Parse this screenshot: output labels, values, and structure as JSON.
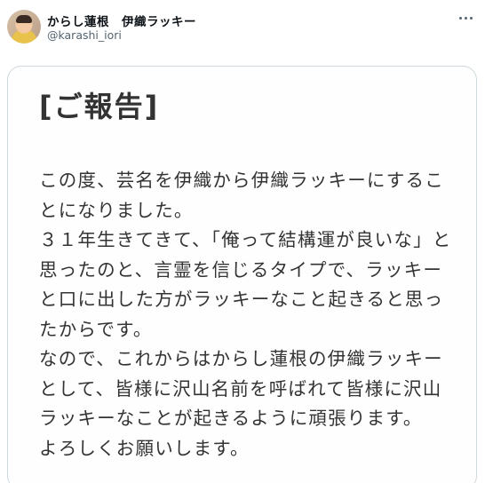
{
  "user": {
    "display_name": "からし蓮根　伊織ラッキー",
    "handle": "@karashi_iori"
  },
  "menu": {
    "icon": "more-horizontal-icon"
  },
  "image": {
    "title": "[ご報告]",
    "lines": [
      "この度、芸名を伊織から伊織ラッキーにするこ",
      "とになりました。",
      "３１年生きてきて、「俺って結構運が良いな」と",
      "思ったのと、言霊を信じるタイプで、ラッキー",
      "と口に出した方がラッキーなこと起きると思っ",
      "たからです。",
      "なので、これからはからし蓮根の伊織ラッキー",
      "として、皆様に沢山名前を呼ばれて皆様に沢山",
      "ラッキーなことが起きるように頑張ります。",
      "よろしくお願いします。"
    ]
  }
}
